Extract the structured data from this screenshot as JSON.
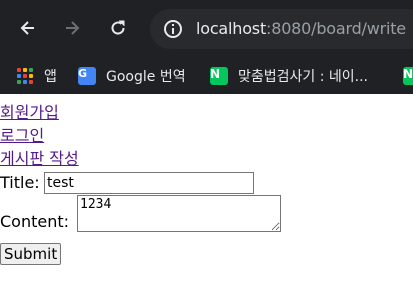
{
  "browser": {
    "url_host": "localhost",
    "url_rest": ":8080/board/write",
    "bookmarks": [
      {
        "label": "앱",
        "icon": "apps-grid-icon"
      },
      {
        "label": "Google 번역",
        "icon": "google-translate-icon"
      },
      {
        "label": "맞춤법검사기 : 네이...",
        "icon": "naver-icon"
      },
      {
        "label": "",
        "icon": "naver-icon"
      }
    ],
    "naver_letter": "N",
    "translate_letter": "G"
  },
  "nav_links": [
    "회원가입",
    "로그인",
    "게시판 작성"
  ],
  "form": {
    "title_label": "Title:",
    "title_value": "test",
    "content_label": "Content:",
    "content_value": "1234",
    "submit_label": "Submit"
  }
}
